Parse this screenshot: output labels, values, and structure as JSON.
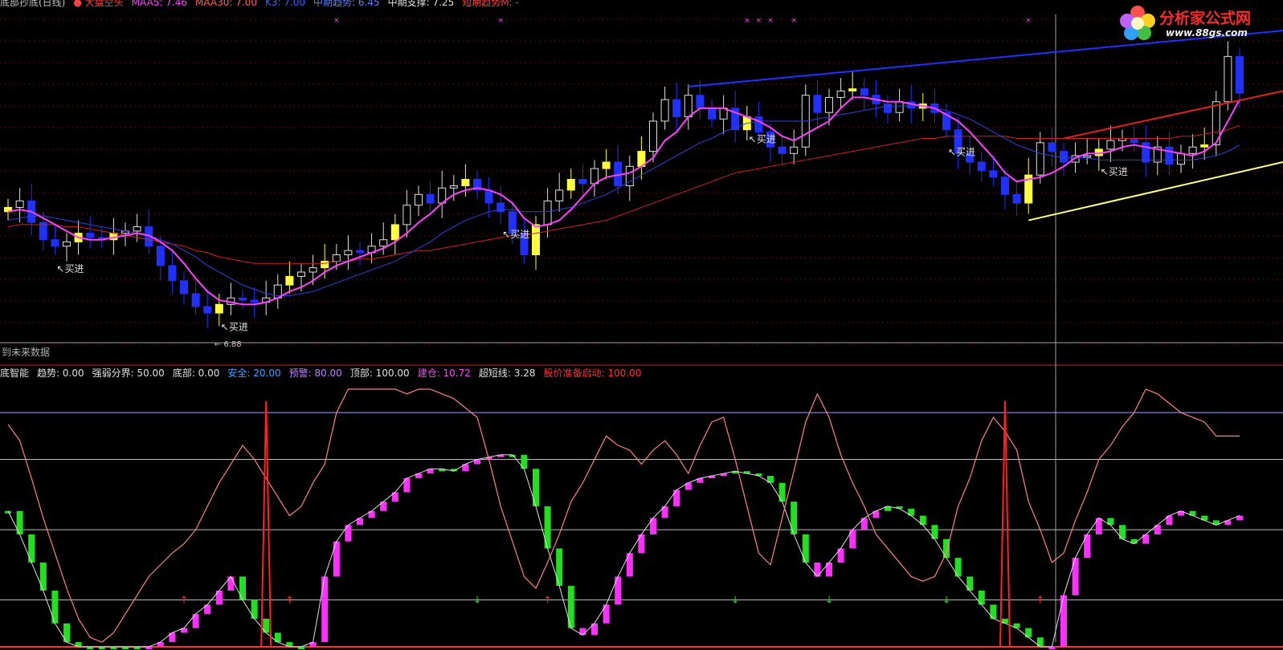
{
  "header_top": [
    {
      "text": "底部抄底(日线)",
      "color": "#c0c0c0"
    },
    {
      "text": "● 大盘空头",
      "color": "#ff4040"
    },
    {
      "text": "MAA5: 7.46",
      "color": "#ff40ff"
    },
    {
      "text": "MAA30: 7.00",
      "color": "#ff6060"
    },
    {
      "text": "K3: 7.00",
      "color": "#4060ff"
    },
    {
      "text": "中期趋势: 6.45",
      "color": "#6080ff"
    },
    {
      "text": "中期支撑: 7.25",
      "color": "#e0e0e0"
    },
    {
      "text": "短期趋势M: -",
      "color": "#ff4040"
    }
  ],
  "header_bottom": [
    {
      "text": "底智能",
      "color": "#e0e0e0"
    },
    {
      "text": "趋势: 0.00",
      "color": "#e0e0e0"
    },
    {
      "text": "强弱分界: 50.00",
      "color": "#e0e0e0"
    },
    {
      "text": "底部: 0.00",
      "color": "#e0e0e0"
    },
    {
      "text": "安全: 20.00",
      "color": "#40a0ff"
    },
    {
      "text": "预警: 80.00",
      "color": "#c080ff"
    },
    {
      "text": "顶部: 100.00",
      "color": "#e0e0e0"
    },
    {
      "text": "建仓: 10.72",
      "color": "#ff40ff"
    },
    {
      "text": "超短线: 3.28",
      "color": "#e0e0e0"
    },
    {
      "text": "股价准备启动: 100.00",
      "color": "#ff3030"
    }
  ],
  "no_future_data_label": "到未来数据",
  "logo": {
    "title": "分析家公式网",
    "url": "www.88gs.com"
  },
  "signal_label": "买进",
  "low_price_label": "6.88",
  "colors": {
    "bull_candle": "#ffff40",
    "bear_candle": "#2030ff",
    "hollow_candle": "#e0e0e0",
    "ma_fast": "#ff40ff",
    "ma_mid": "#3040e0",
    "ma_slow": "#d02020",
    "trend_blue": "#2030ff",
    "trend_red": "#e02020",
    "trend_yellow": "#ffff80",
    "osc_rise": "#ff30ff",
    "osc_fall": "#20e020",
    "osc_line": "#ff8080"
  },
  "chart_data": [
    {
      "type": "candlestick",
      "panel": "price",
      "ylim": [
        6.8,
        8.3
      ],
      "x": [
        0,
        1,
        2,
        3,
        4,
        5,
        6,
        7,
        8,
        9,
        10,
        11,
        12,
        13,
        14,
        15,
        16,
        17,
        18,
        19,
        20,
        21,
        22,
        23,
        24,
        25,
        26,
        27,
        28,
        29,
        30,
        31,
        32,
        33,
        34,
        35,
        36,
        37,
        38,
        39,
        40,
        41,
        42,
        43,
        44,
        45,
        46,
        47,
        48,
        49,
        50,
        51,
        52,
        53,
        54,
        55,
        56,
        57,
        58,
        59,
        60,
        61,
        62,
        63,
        64,
        65,
        66,
        67,
        68,
        69,
        70,
        71,
        72,
        73,
        74,
        75,
        76,
        77,
        78,
        79,
        80,
        81,
        82,
        83,
        84,
        85,
        86,
        87,
        88,
        89,
        90,
        91,
        92,
        93,
        94,
        95,
        96,
        97,
        98,
        99,
        100,
        101,
        102,
        103,
        104,
        105
      ],
      "close": [
        7.42,
        7.45,
        7.35,
        7.27,
        7.24,
        7.26,
        7.3,
        7.28,
        7.27,
        7.3,
        7.31,
        7.33,
        7.24,
        7.15,
        7.08,
        7.02,
        6.96,
        6.93,
        6.97,
        7.0,
        6.99,
        6.98,
        7.0,
        7.06,
        7.1,
        7.12,
        7.14,
        7.17,
        7.2,
        7.22,
        7.21,
        7.24,
        7.27,
        7.34,
        7.43,
        7.48,
        7.44,
        7.51,
        7.52,
        7.55,
        7.5,
        7.44,
        7.4,
        7.3,
        7.2,
        7.34,
        7.45,
        7.5,
        7.55,
        7.53,
        7.6,
        7.63,
        7.52,
        7.61,
        7.68,
        7.82,
        7.92,
        7.84,
        7.94,
        7.88,
        7.83,
        7.88,
        7.78,
        7.84,
        7.77,
        7.7,
        7.67,
        7.7,
        7.94,
        7.86,
        7.93,
        7.96,
        7.97,
        7.94,
        7.9,
        7.86,
        7.91,
        7.88,
        7.9,
        7.86,
        7.78,
        7.67,
        7.63,
        7.59,
        7.56,
        7.48,
        7.44,
        7.57,
        7.72,
        7.68,
        7.63,
        7.66,
        7.66,
        7.69,
        7.73,
        7.74,
        7.72,
        7.63,
        7.7,
        7.62,
        7.67,
        7.7,
        7.71,
        7.91,
        8.12,
        7.95
      ],
      "open": [
        7.4,
        7.42,
        7.45,
        7.35,
        7.27,
        7.24,
        7.26,
        7.3,
        7.28,
        7.27,
        7.3,
        7.31,
        7.33,
        7.24,
        7.15,
        7.08,
        7.02,
        6.96,
        6.93,
        6.97,
        7.0,
        6.99,
        6.98,
        7.0,
        7.06,
        7.1,
        7.12,
        7.14,
        7.17,
        7.2,
        7.22,
        7.21,
        7.24,
        7.27,
        7.34,
        7.43,
        7.48,
        7.44,
        7.51,
        7.52,
        7.55,
        7.5,
        7.44,
        7.4,
        7.3,
        7.2,
        7.34,
        7.45,
        7.5,
        7.55,
        7.53,
        7.6,
        7.63,
        7.52,
        7.61,
        7.68,
        7.82,
        7.92,
        7.84,
        7.94,
        7.88,
        7.83,
        7.88,
        7.78,
        7.84,
        7.77,
        7.7,
        7.67,
        7.7,
        7.94,
        7.86,
        7.93,
        7.96,
        7.97,
        7.94,
        7.9,
        7.86,
        7.91,
        7.88,
        7.9,
        7.86,
        7.78,
        7.67,
        7.63,
        7.59,
        7.56,
        7.48,
        7.44,
        7.57,
        7.72,
        7.68,
        7.63,
        7.66,
        7.66,
        7.69,
        7.73,
        7.74,
        7.72,
        7.63,
        7.7,
        7.62,
        7.67,
        7.7,
        7.71,
        7.91,
        8.12
      ],
      "signals": [
        4,
        18,
        42,
        63,
        80,
        93
      ],
      "ma5": [
        7.4,
        7.41,
        7.4,
        7.37,
        7.34,
        7.31,
        7.28,
        7.27,
        7.27,
        7.28,
        7.29,
        7.3,
        7.29,
        7.26,
        7.22,
        7.16,
        7.09,
        7.03,
        6.99,
        6.98,
        6.97,
        6.97,
        6.98,
        7.0,
        7.03,
        7.05,
        7.08,
        7.12,
        7.15,
        7.17,
        7.19,
        7.21,
        7.23,
        7.26,
        7.3,
        7.35,
        7.39,
        7.44,
        7.48,
        7.5,
        7.51,
        7.5,
        7.48,
        7.44,
        7.37,
        7.33,
        7.34,
        7.36,
        7.41,
        7.47,
        7.53,
        7.56,
        7.57,
        7.58,
        7.61,
        7.65,
        7.73,
        7.77,
        7.84,
        7.88,
        7.88,
        7.88,
        7.86,
        7.84,
        7.82,
        7.79,
        7.75,
        7.73,
        7.76,
        7.79,
        7.82,
        7.88,
        7.93,
        7.93,
        7.92,
        7.91,
        7.91,
        7.9,
        7.89,
        7.88,
        7.85,
        7.82,
        7.77,
        7.71,
        7.65,
        7.58,
        7.54,
        7.55,
        7.56,
        7.58,
        7.61,
        7.65,
        7.67,
        7.67,
        7.68,
        7.7,
        7.71,
        7.7,
        7.69,
        7.68,
        7.67,
        7.66,
        7.68,
        7.72,
        7.82,
        7.92
      ],
      "ma10": [
        7.36,
        7.37,
        7.38,
        7.38,
        7.37,
        7.36,
        7.35,
        7.34,
        7.33,
        7.32,
        7.31,
        7.3,
        7.29,
        7.27,
        7.25,
        7.22,
        7.19,
        7.15,
        7.12,
        7.09,
        7.06,
        7.04,
        7.02,
        7.01,
        7.01,
        7.02,
        7.03,
        7.05,
        7.07,
        7.09,
        7.11,
        7.13,
        7.15,
        7.17,
        7.2,
        7.23,
        7.26,
        7.3,
        7.33,
        7.36,
        7.38,
        7.4,
        7.41,
        7.41,
        7.4,
        7.4,
        7.4,
        7.41,
        7.42,
        7.44,
        7.46,
        7.48,
        7.51,
        7.54,
        7.57,
        7.6,
        7.63,
        7.66,
        7.69,
        7.72,
        7.74,
        7.77,
        7.79,
        7.81,
        7.82,
        7.82,
        7.82,
        7.82,
        7.82,
        7.83,
        7.84,
        7.85,
        7.86,
        7.87,
        7.88,
        7.89,
        7.89,
        7.89,
        7.89,
        7.88,
        7.87,
        7.85,
        7.83,
        7.8,
        7.77,
        7.74,
        7.71,
        7.69,
        7.67,
        7.66,
        7.65,
        7.65,
        7.65,
        7.64,
        7.64,
        7.64,
        7.64,
        7.64,
        7.64,
        7.64,
        7.64,
        7.64,
        7.65,
        7.66,
        7.68,
        7.71
      ],
      "ma30": [
        7.33,
        7.34,
        7.34,
        7.34,
        7.34,
        7.33,
        7.33,
        7.32,
        7.31,
        7.3,
        7.29,
        7.28,
        7.27,
        7.26,
        7.25,
        7.24,
        7.22,
        7.21,
        7.19,
        7.18,
        7.17,
        7.16,
        7.16,
        7.16,
        7.16,
        7.16,
        7.16,
        7.16,
        7.17,
        7.17,
        7.18,
        7.18,
        7.19,
        7.2,
        7.21,
        7.22,
        7.22,
        7.23,
        7.24,
        7.25,
        7.26,
        7.27,
        7.28,
        7.29,
        7.29,
        7.3,
        7.31,
        7.32,
        7.33,
        7.34,
        7.35,
        7.36,
        7.38,
        7.4,
        7.42,
        7.44,
        7.46,
        7.48,
        7.5,
        7.52,
        7.54,
        7.56,
        7.58,
        7.59,
        7.6,
        7.61,
        7.62,
        7.63,
        7.64,
        7.65,
        7.66,
        7.67,
        7.68,
        7.69,
        7.7,
        7.71,
        7.72,
        7.73,
        7.74,
        7.74,
        7.75,
        7.75,
        7.75,
        7.75,
        7.75,
        7.75,
        7.74,
        7.74,
        7.74,
        7.74,
        7.74,
        7.74,
        7.74,
        7.74,
        7.74,
        7.74,
        7.74,
        7.74,
        7.74,
        7.74,
        7.75,
        7.75,
        7.76,
        7.77,
        7.78,
        7.8
      ]
    },
    {
      "type": "bar",
      "panel": "oscillator",
      "ylim": [
        0,
        110
      ],
      "levels": [
        20,
        50,
        80,
        100
      ],
      "x": [
        0,
        1,
        2,
        3,
        4,
        5,
        6,
        7,
        8,
        9,
        10,
        11,
        12,
        13,
        14,
        15,
        16,
        17,
        18,
        19,
        20,
        21,
        22,
        23,
        24,
        25,
        26,
        27,
        28,
        29,
        30,
        31,
        32,
        33,
        34,
        35,
        36,
        37,
        38,
        39,
        40,
        41,
        42,
        43,
        44,
        45,
        46,
        47,
        48,
        49,
        50,
        51,
        52,
        53,
        54,
        55,
        56,
        57,
        58,
        59,
        60,
        61,
        62,
        63,
        64,
        65,
        66,
        67,
        68,
        69,
        70,
        71,
        72,
        73,
        74,
        75,
        76,
        77,
        78,
        79,
        80,
        81,
        82,
        83,
        84,
        85,
        86,
        87,
        88,
        89,
        90,
        91,
        92,
        93,
        94,
        95,
        96,
        97,
        98,
        99,
        100,
        101,
        102,
        103,
        104,
        105
      ],
      "trend": [
        58,
        48,
        36,
        24,
        10,
        2,
        0,
        0,
        0,
        0,
        0,
        0,
        0,
        2,
        6,
        8,
        14,
        18,
        24,
        30,
        20,
        12,
        6,
        2,
        0,
        0,
        2,
        30,
        45,
        52,
        55,
        58,
        62,
        66,
        72,
        74,
        76,
        76,
        75,
        78,
        80,
        81,
        82,
        82,
        76,
        60,
        42,
        26,
        8,
        5,
        10,
        18,
        30,
        40,
        48,
        55,
        60,
        67,
        70,
        72,
        73,
        74,
        75,
        74,
        73,
        70,
        62,
        48,
        36,
        30,
        36,
        42,
        50,
        55,
        58,
        60,
        59,
        56,
        52,
        46,
        38,
        30,
        24,
        18,
        12,
        10,
        8,
        4,
        0,
        0,
        22,
        38,
        48,
        55,
        52,
        46,
        44,
        48,
        52,
        56,
        58,
        56,
        54,
        52,
        54,
        56
      ],
      "rise": [
        0,
        0,
        0,
        0,
        0,
        0,
        0,
        0,
        0,
        0,
        0,
        0,
        1,
        1,
        1,
        1,
        1,
        1,
        1,
        1,
        0,
        0,
        0,
        0,
        0,
        0,
        1,
        1,
        1,
        1,
        1,
        1,
        1,
        1,
        1,
        1,
        1,
        0,
        0,
        1,
        1,
        1,
        1,
        0,
        0,
        0,
        0,
        0,
        0,
        1,
        1,
        1,
        1,
        1,
        1,
        1,
        1,
        1,
        1,
        1,
        1,
        1,
        0,
        0,
        0,
        0,
        0,
        0,
        0,
        1,
        1,
        1,
        1,
        1,
        1,
        0,
        0,
        0,
        0,
        0,
        0,
        0,
        0,
        0,
        0,
        0,
        0,
        0,
        0,
        1,
        1,
        1,
        1,
        1,
        0,
        0,
        0,
        1,
        1,
        1,
        1,
        0,
        0,
        0,
        1,
        1
      ],
      "line": [
        95,
        88,
        72,
        55,
        40,
        25,
        12,
        4,
        2,
        6,
        14,
        22,
        30,
        35,
        40,
        44,
        50,
        60,
        70,
        78,
        86,
        80,
        72,
        64,
        56,
        60,
        70,
        78,
        100,
        110,
        112,
        112,
        112,
        110,
        108,
        112,
        110,
        108,
        106,
        102,
        98,
        80,
        60,
        45,
        30,
        25,
        36,
        48,
        62,
        70,
        80,
        90,
        86,
        84,
        78,
        84,
        88,
        82,
        74,
        86,
        96,
        98,
        80,
        60,
        40,
        35,
        55,
        75,
        96,
        108,
        98,
        82,
        70,
        60,
        48,
        42,
        36,
        30,
        28,
        30,
        40,
        60,
        72,
        88,
        98,
        92,
        84,
        62,
        50,
        36,
        40,
        54,
        66,
        80,
        86,
        94,
        100,
        110,
        108,
        104,
        100,
        98,
        96,
        90,
        90,
        90
      ],
      "spikes": [
        22,
        85
      ],
      "arrows_up": [
        15,
        24,
        46,
        88
      ],
      "arrows_down": [
        40,
        62,
        70,
        80
      ]
    }
  ]
}
